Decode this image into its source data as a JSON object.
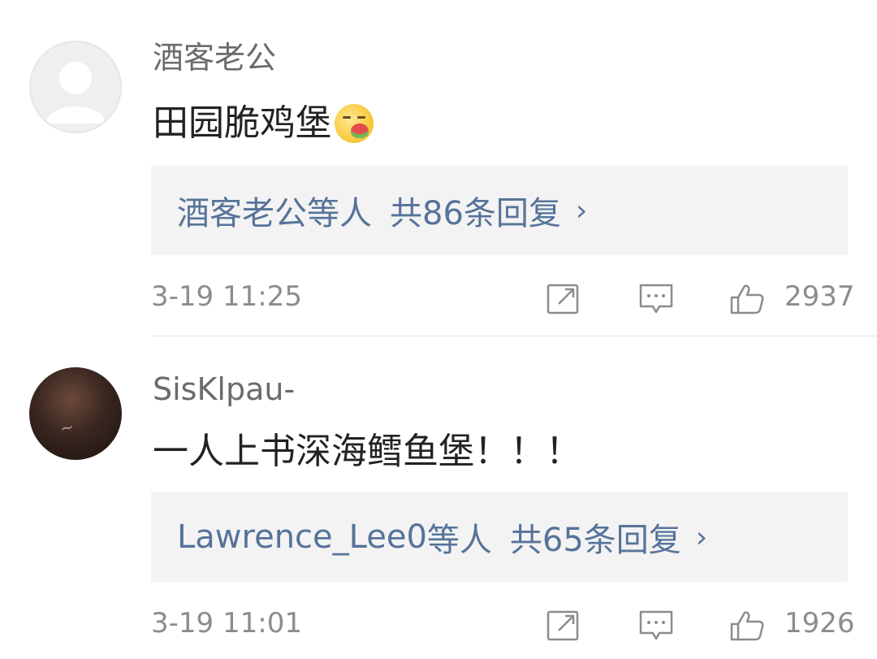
{
  "comments": [
    {
      "username": "酒客老公",
      "content": "田园脆鸡堡",
      "emoji": "drooling-emoji",
      "reply_names": "酒客老公",
      "reply_suffix": "等人",
      "reply_count": "共86条回复",
      "reply_chevron": "›",
      "time": "3-19 11:25",
      "likes": "2937"
    },
    {
      "username": "SisKlpau-",
      "content": "一人上书深海鳕鱼堡！！！",
      "reply_names": "Lawrence_Lee0",
      "reply_suffix": "等人",
      "reply_count": "共65条回复",
      "reply_chevron": "›",
      "time": "3-19 11:01",
      "likes": "1926"
    }
  ],
  "colors": {
    "link": "#56739a",
    "meta": "#8c8c8c",
    "username": "#6b6b6b",
    "reply_bg": "#f3f3f3"
  }
}
